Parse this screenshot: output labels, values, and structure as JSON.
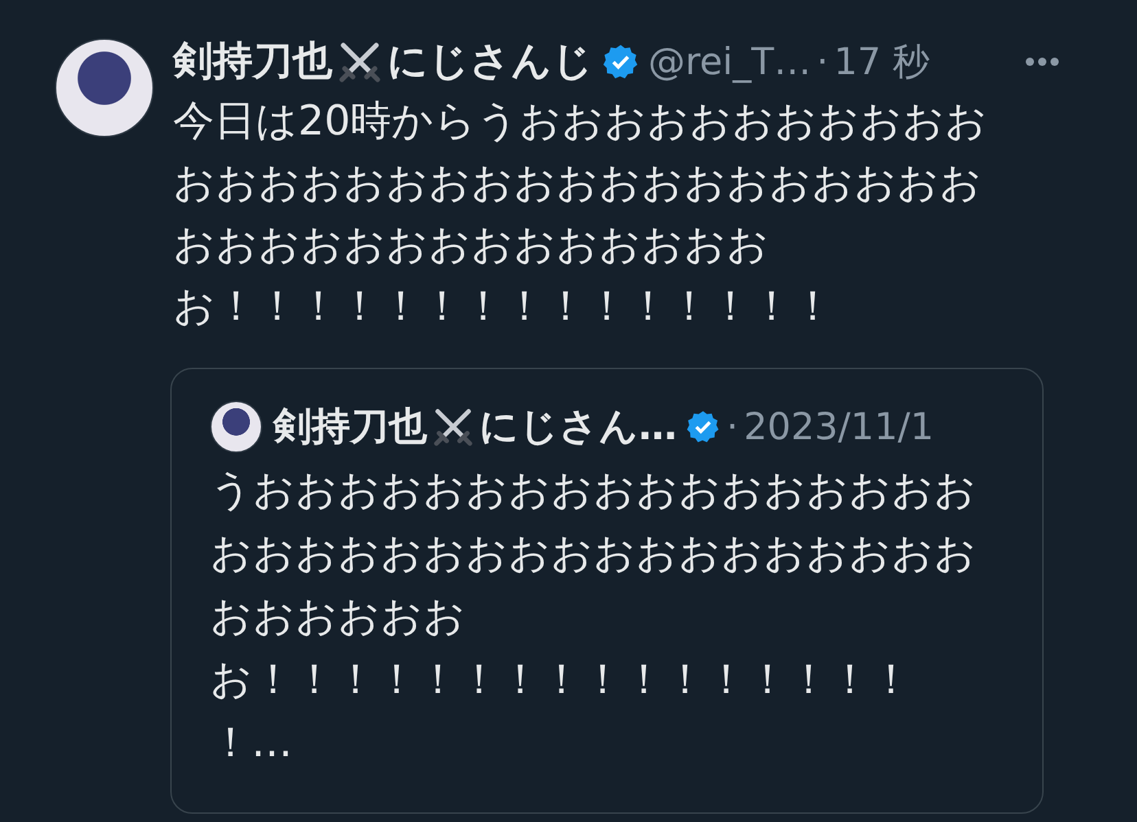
{
  "tweet": {
    "name_before_icon": "剣持刀也",
    "name_after_icon": "にじさんじ",
    "verified": true,
    "handle": "@rei_T…",
    "separator": "·",
    "time": "17 秒",
    "lines": [
      "今日は20時からうおおおおおおおおおおお",
      "おおおおおおおおおおおおおおおおおおお",
      "おおおおおおおおおおおおおお",
      "お！！！！！！！！！！！！！！！"
    ],
    "quote": {
      "name_before_icon": "剣持刀也",
      "name_after_icon": "にじさん…",
      "verified": true,
      "separator": "·",
      "date": "2023/11/1",
      "lines": [
        "うおおおおおおおおおおおおおおおおお",
        "おおおおおおおおおおおおおおおおおお",
        "おおおおおお",
        "お！！！！！！！！！！！！！！！！",
        "！…"
      ]
    }
  }
}
